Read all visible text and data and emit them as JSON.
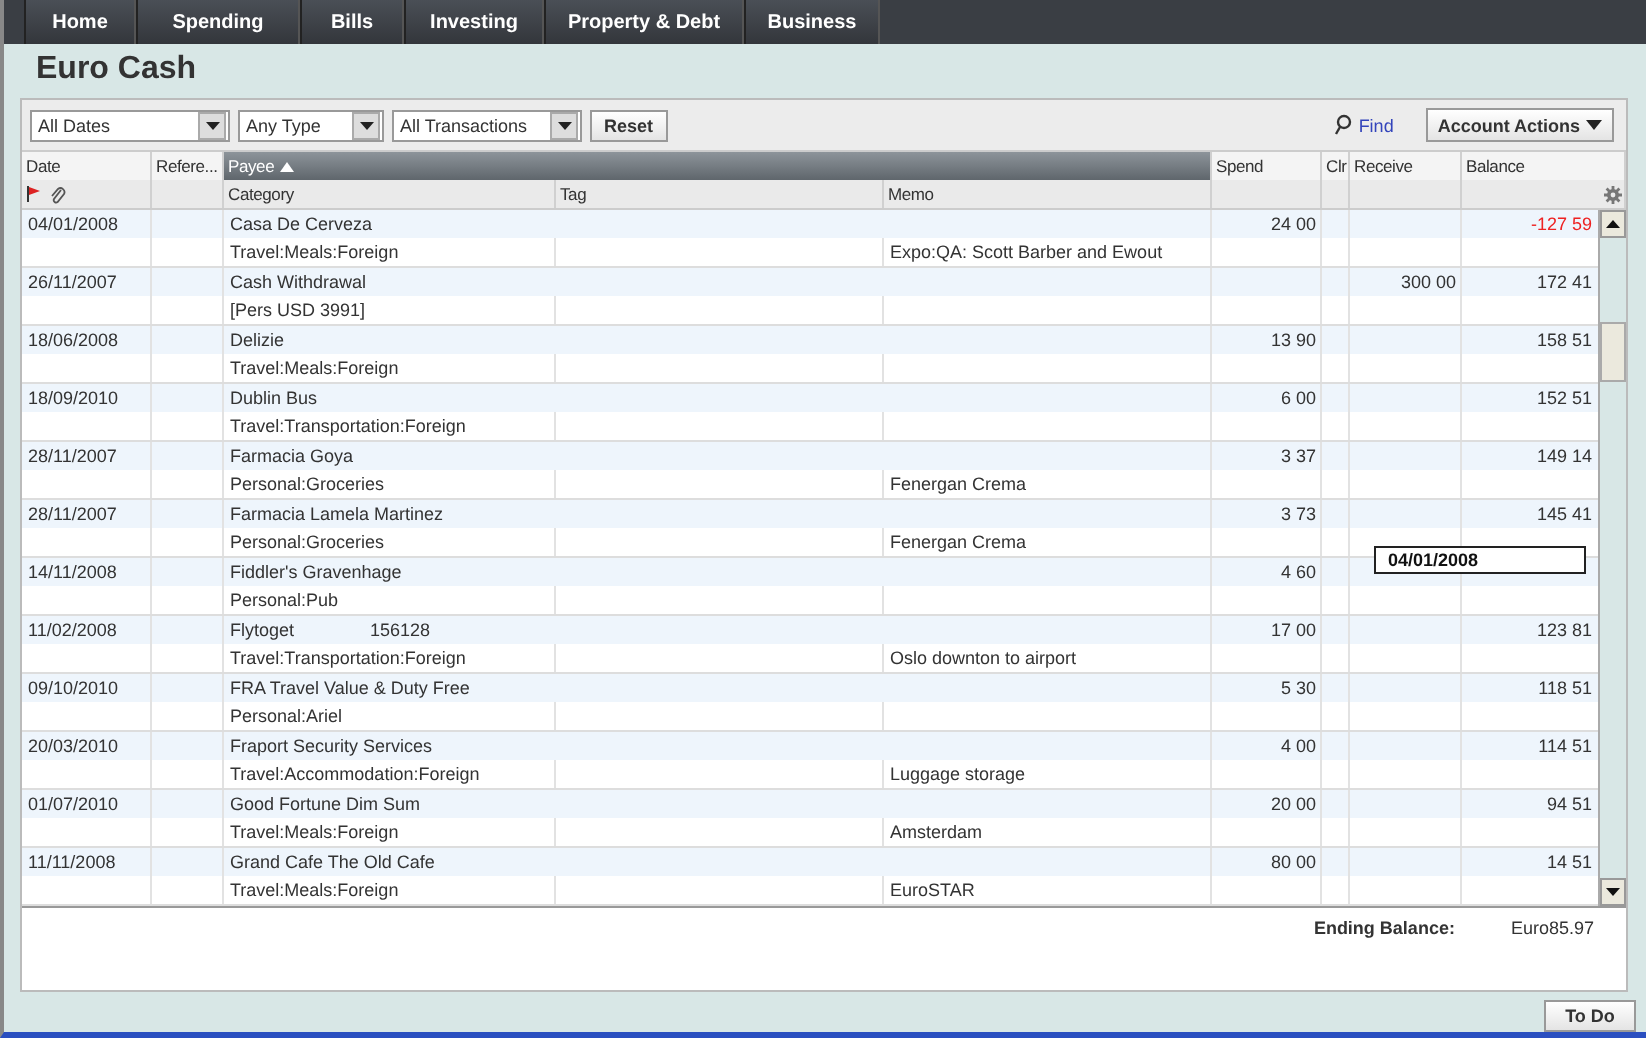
{
  "nav_tabs": [
    {
      "label": "Home",
      "selected": false
    },
    {
      "label": "Spending",
      "selected": false
    },
    {
      "label": "Bills",
      "selected": false
    },
    {
      "label": "Investing",
      "selected": false
    },
    {
      "label": "Property & Debt",
      "selected": false
    },
    {
      "label": "Business",
      "selected": false
    }
  ],
  "account": {
    "title": "Euro Cash"
  },
  "filters": [
    {
      "value": "All Dates"
    },
    {
      "value": "Any Type"
    },
    {
      "value": "All Transactions"
    }
  ],
  "reset_button": "Reset",
  "find_link": "Find",
  "account_actions_button": "Account Actions",
  "table": {
    "columns": [
      {
        "label": "Date",
        "sorted": false
      },
      {
        "label": "Refere...",
        "sorted": false
      },
      {
        "label": "Payee",
        "sorted": true
      },
      {
        "label": "Spend",
        "sorted": false
      },
      {
        "label": "Clr",
        "sorted": false
      },
      {
        "label": "Receive",
        "sorted": false
      },
      {
        "label": "Balance",
        "sorted": false
      }
    ],
    "sub_columns": [
      "Category",
      "Tag",
      "Memo"
    ],
    "rows": [
      {
        "date": "04/01/2008",
        "payee": "Casa De Cerveza",
        "category": "Travel:Meals:Foreign",
        "memo": "Expo:QA:  Scott Barber and Ewout",
        "spend": "24 00",
        "balance": "-127 59",
        "negative": true
      },
      {
        "date": "26/11/2007",
        "payee": "Cash Withdrawal",
        "category": "[Pers USD 3991]",
        "receive": "300 00",
        "balance": "172 41",
        "negative": false
      },
      {
        "date": "18/06/2008",
        "payee": "Delizie",
        "category": "Travel:Meals:Foreign",
        "spend": "13 90",
        "balance": "158 51",
        "negative": false
      },
      {
        "date": "18/09/2010",
        "payee": "Dublin Bus",
        "category": "Travel:Transportation:Foreign",
        "spend": "6 00",
        "balance": "152 51",
        "negative": false
      },
      {
        "date": "28/11/2007",
        "payee": "Farmacia Goya",
        "category": "Personal:Groceries",
        "memo": "Fenergan Crema",
        "spend": "3 37",
        "balance": "149 14",
        "negative": false
      },
      {
        "date": "28/11/2007",
        "payee": "Farmacia Lamela Martinez",
        "category": "Personal:Groceries",
        "memo": "Fenergan Crema",
        "spend": "3 73",
        "balance": "145 41",
        "negative": false
      },
      {
        "date": "14/11/2008",
        "payee": "Fiddler's Gravenhage",
        "category": "Personal:Pub",
        "spend": "4 60"
      },
      {
        "date": "11/02/2008",
        "payee": "Flytoget",
        "number": "156128",
        "category": "Travel:Transportation:Foreign",
        "memo": "Oslo downton to airport",
        "spend": "17 00",
        "balance": "123 81",
        "negative": false
      },
      {
        "date": "09/10/2010",
        "payee": "FRA Travel Value & Duty Free",
        "category": "Personal:Ariel",
        "spend": "5 30",
        "balance": "118 51",
        "negative": false
      },
      {
        "date": "20/03/2010",
        "payee": "Fraport Security Services",
        "category": "Travel:Accommodation:Foreign",
        "memo": "Luggage storage",
        "spend": "4 00",
        "balance": "114 51",
        "negative": false
      },
      {
        "date": "01/07/2010",
        "payee": "Good Fortune Dim Sum",
        "category": "Travel:Meals:Foreign",
        "memo": "Amsterdam",
        "spend": "20 00",
        "balance": "94 51",
        "negative": false
      },
      {
        "date": "11/11/2008",
        "payee": "Grand Cafe The Old Cafe",
        "category": "Travel:Meals:Foreign",
        "memo": "EuroSTAR",
        "spend": "80 00",
        "balance": "14 51",
        "negative": false
      }
    ]
  },
  "tooltip": "04/01/2008",
  "ending_balance": {
    "label": "Ending Balance:",
    "value": "Euro85.97"
  },
  "todo_button": "To Do"
}
